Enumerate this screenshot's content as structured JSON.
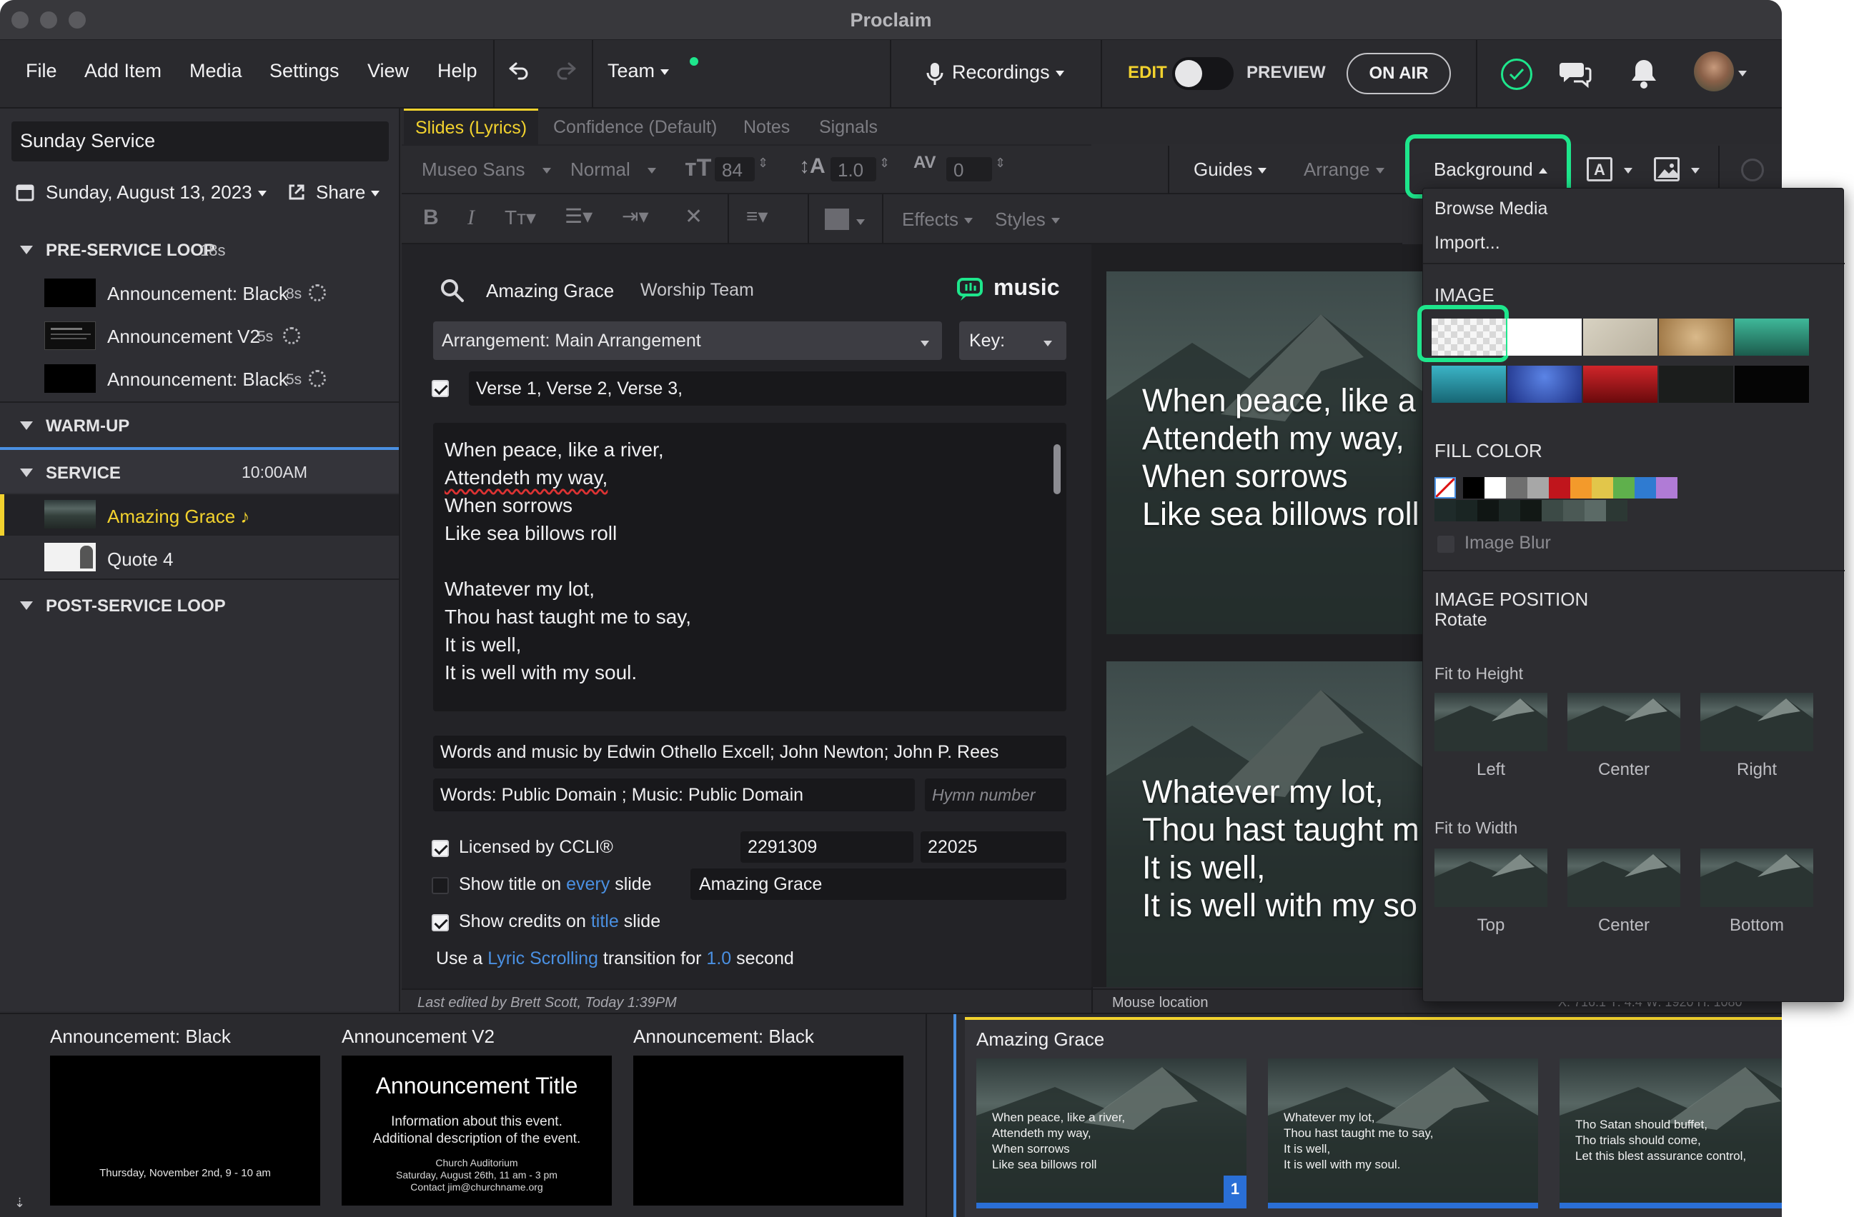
{
  "window": {
    "title": "Proclaim"
  },
  "menu": {
    "items": [
      "File",
      "Add Item",
      "Media",
      "Settings",
      "View",
      "Help"
    ],
    "team_label": "Team",
    "recordings_label": "Recordings",
    "edit_label": "EDIT",
    "preview_label": "PREVIEW",
    "on_air_label": "ON AIR"
  },
  "sidebar": {
    "service_name": "Sunday Service",
    "date": "Sunday, August 13, 2023",
    "share_label": "Share",
    "groups": [
      {
        "title": "PRE-SERVICE LOOP",
        "meta": "18s",
        "items": [
          {
            "label": "Announcement: Black",
            "duration": "8s"
          },
          {
            "label": "Announcement V2",
            "duration": "5s"
          },
          {
            "label": "Announcement: Black",
            "duration": "5s"
          }
        ]
      },
      {
        "title": "WARM-UP",
        "meta": ""
      },
      {
        "title": "SERVICE",
        "meta": "10:00AM",
        "items": [
          {
            "label": "Amazing Grace ♪",
            "selected": true
          },
          {
            "label": "Quote 4"
          }
        ]
      },
      {
        "title": "POST-SERVICE LOOP",
        "meta": ""
      }
    ]
  },
  "tabs": [
    "Slides (Lyrics)",
    "Confidence (Default)",
    "Notes",
    "Signals"
  ],
  "toolbar": {
    "font": "Museo Sans",
    "weight": "Normal",
    "size": "84",
    "line_height": "1.0",
    "spacing": "0",
    "guides": "Guides",
    "arrange": "Arrange",
    "background": "Background",
    "effects": "Effects",
    "styles": "Styles"
  },
  "song": {
    "title": "Amazing Grace",
    "author": "Worship Team",
    "music_brand": "music",
    "arrangement": "Arrangement: Main Arrangement",
    "key_label": "Key:",
    "sequence": "Verse 1, Verse 2, Verse 3,",
    "lyrics": [
      "When peace, like a river,",
      "Attendeth my way,",
      "When sorrows",
      "Like sea billows roll",
      "",
      "Whatever my lot,",
      "Thou hast taught me to say,",
      "It is well,",
      "It is well with my soul."
    ],
    "credits": "Words and music by Edwin Othello Excell; John Newton; John P. Rees",
    "copyright": "Words: Public Domain ; Music: Public Domain",
    "hymn_placeholder": "Hymn number",
    "ccli_label": "Licensed by CCLI®",
    "ccli_number": "2291309",
    "ccli_license": "22025",
    "show_title_pre": "Show title on",
    "show_title_link": "every",
    "show_title_post": "slide",
    "show_title_value": "Amazing Grace",
    "show_credits_pre": "Show credits on",
    "show_credits_link": "title",
    "show_credits_post": "slide",
    "transition_pre": "Use a",
    "transition_link": "Lyric Scrolling",
    "transition_mid": "transition for",
    "transition_value": "1.0",
    "transition_post": "second",
    "last_edited": "Last edited by Brett Scott, Today 1:39PM",
    "mouse_location": "Mouse location",
    "coords": "X: 716.1  Y: 4.4   W: 1920  H: 1080"
  },
  "preview": {
    "slide1": [
      "When peace, like a",
      "Attendeth my way,",
      "When sorrows",
      "Like sea billows roll"
    ],
    "slide2": [
      "Whatever my lot,",
      "Thou hast taught m",
      "It is well,",
      "It is well with my so"
    ]
  },
  "background_menu": {
    "browse": "Browse Media",
    "import": "Import...",
    "image_section": "IMAGE",
    "image_swatches": [
      "#e9e9e9",
      "#ffffff",
      "#c9c3b3",
      "#b8956a",
      "#2f8f78",
      "#2fa0b0",
      "#3556b8",
      "#b81d1d",
      "#1b1d1c",
      "#050505"
    ],
    "fill_section": "FILL COLOR",
    "fill_colors": [
      "#000000",
      "#ffffff",
      "#6f6f6f",
      "#a7a7a7",
      "#c0151c",
      "#f39a2b",
      "#e2c64a",
      "#5fb04c",
      "#2f7bd1",
      "#b07bd6"
    ],
    "fill_colors_row2": [
      "#1f2b2a",
      "#1a2523",
      "#101614",
      "#1c2624",
      "#121815",
      "#3c4a46",
      "#4b5955",
      "#5b6a66",
      "#2c3834"
    ],
    "image_blur": "Image Blur",
    "position_section": "IMAGE POSITION",
    "rotate": "Rotate",
    "fit_height": "Fit to Height",
    "fit_height_opts": [
      "Left",
      "Center",
      "Right"
    ],
    "fit_width": "Fit to Width",
    "fit_width_opts": [
      "Top",
      "Center",
      "Bottom"
    ]
  },
  "bottom_strip": {
    "pre_items": [
      {
        "label": "Announcement: Black",
        "caption": "Thursday, November 2nd, 9 - 10 am"
      },
      {
        "label": "Announcement V2",
        "title": "Announcement Title",
        "lines": [
          "Information about this event.",
          "Additional description of the event."
        ],
        "small": [
          "Church Auditorium",
          "Saturday, August 26th, 11 am - 3 pm",
          "Contact jim@churchname.org"
        ]
      },
      {
        "label": "Announcement: Black"
      }
    ],
    "song_label": "Amazing Grace",
    "song_slides": [
      [
        "When peace, like a river,",
        "Attendeth my way,",
        "When sorrows",
        "Like sea billows roll"
      ],
      [
        "Whatever my lot,",
        "Thou hast taught me to say,",
        "It is well,",
        "It is well with my soul."
      ],
      [
        "Tho Satan should buffet,",
        "Tho trials should come,",
        "Let this blest assurance control,"
      ]
    ],
    "slide_badge": "1"
  },
  "colors": {
    "accent_green": "#1ee68c",
    "accent_yellow": "#f2d22e",
    "link_blue": "#4a90e2"
  }
}
